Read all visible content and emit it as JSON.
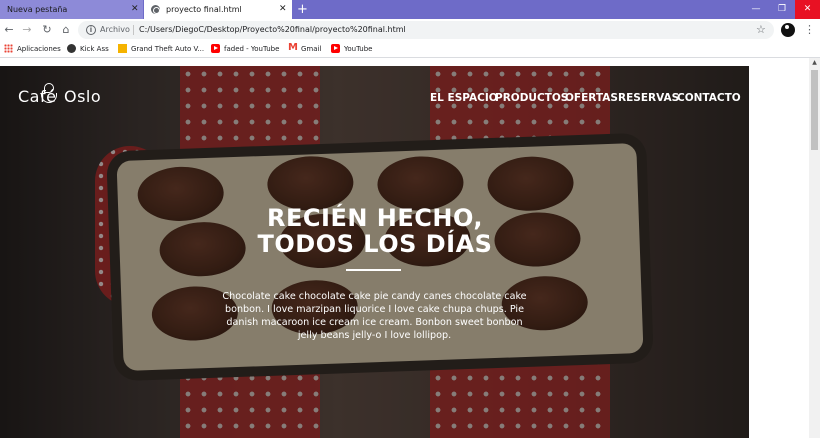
{
  "browser": {
    "tabs": [
      {
        "label": "Nueva pestaña",
        "close": "✕"
      },
      {
        "label": "proyecto final.html",
        "close": "✕"
      }
    ],
    "new_tab": "+",
    "window_controls": {
      "minimize": "—",
      "maximize": "❐",
      "close": "✕"
    },
    "nav": {
      "back": "←",
      "forward": "→",
      "reload": "↻",
      "home": "⌂"
    },
    "address": {
      "security_icon": "i",
      "scheme_label": "Archivo",
      "url": "C:/Users/DiegoC/Desktop/Proyecto%20final/proyecto%20final.html"
    },
    "star_icon": "☆",
    "menu_icon": "⋮",
    "bookmarks": [
      {
        "label": "Aplicaciones",
        "icon": "apps-icon"
      },
      {
        "label": "Kick Ass",
        "icon": "globe-icon"
      },
      {
        "label": "Grand Theft Auto V...",
        "icon": "gta-icon"
      },
      {
        "label": "faded - YouTube",
        "icon": "youtube-icon"
      },
      {
        "label": "Gmail",
        "icon": "gmail-icon"
      },
      {
        "label": "YouTube",
        "icon": "youtube-icon"
      }
    ]
  },
  "page": {
    "logo": {
      "left": "Café",
      "right": "Oslo"
    },
    "nav": [
      "EL ESPACIO",
      "PRODUCTOS",
      "OFERTAS",
      "RESERVAS",
      "CONTACTO"
    ],
    "headline": [
      "RECIÉN HECHO,",
      "TODOS LOS DÍAS"
    ],
    "paragraph": "Chocolate cake chocolate cake pie candy canes chocolate cake bonbon. I love marzipan liquorice I love cake chupa chups. Pie danish macaroon ice cream ice cream. Bonbon sweet bonbon jelly beans jelly-o I love lollipop."
  },
  "colors": {
    "tab_strip": "#6e6bc8",
    "close_button": "#e81123",
    "apron_red": "#b52a2a"
  }
}
